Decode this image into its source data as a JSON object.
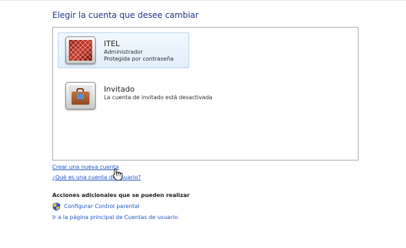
{
  "page_title": "Elegir la cuenta que desee cambiar",
  "accounts": [
    {
      "name": "ITEL",
      "details": [
        "Administrador",
        "Protegida por contraseña"
      ],
      "icon": "account-picture-icon",
      "selected": true
    },
    {
      "name": "Invitado",
      "details": [
        "La cuenta de invitado está desactivada"
      ],
      "icon": "guest-suitcase-icon",
      "selected": false
    }
  ],
  "links": {
    "create_account": "Crear una nueva cuenta",
    "what_is_account": "¿Qué es una cuenta de usuario?"
  },
  "additional_actions": {
    "heading": "Acciones adicionales que se pueden realizar",
    "items": [
      {
        "label": "Configurar Control parental",
        "icon": "uac-shield-icon"
      },
      {
        "label": "Ir a la página principal de Cuentas de usuario"
      }
    ]
  },
  "colors": {
    "title": "#1e3287",
    "link": "#1a56c4",
    "selected_bg": "#e6f0fb",
    "selected_border": "#b6d3f1"
  }
}
